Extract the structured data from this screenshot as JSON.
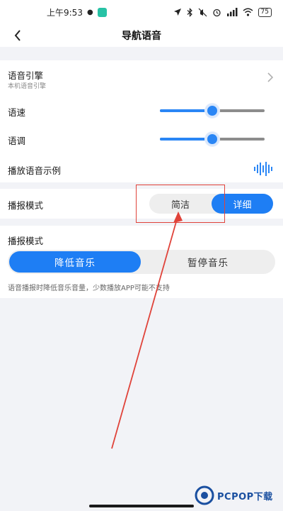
{
  "status_bar": {
    "time": "上午9:53",
    "battery": "75",
    "icons": [
      "location-arrow-icon",
      "bluetooth-icon",
      "mute-icon",
      "alarm-icon",
      "signal-icon",
      "wifi-icon"
    ]
  },
  "nav": {
    "title": "导航语音",
    "back_icon": "chevron-left-icon"
  },
  "settings": {
    "engine_label": "语音引擎",
    "engine_sub": "本机语音引擎",
    "speed_label": "语速",
    "speed_value": 0.5,
    "pitch_label": "语调",
    "pitch_value": 0.5,
    "sample_label": "播放语音示例",
    "mode_label": "播报模式",
    "mode_options": [
      "简洁",
      "详细"
    ],
    "mode_selected": "详细"
  },
  "music": {
    "label": "播报模式",
    "options": [
      "降低音乐",
      "暂停音乐"
    ],
    "selected": "降低音乐",
    "note": "语音播报时降低音乐音量，少数播放APP可能不支持"
  },
  "watermark": {
    "text": "PCPOP下载"
  },
  "colors": {
    "accent": "#1e7ef4",
    "annotation": "#e0433a",
    "background": "#f2f3f7"
  }
}
